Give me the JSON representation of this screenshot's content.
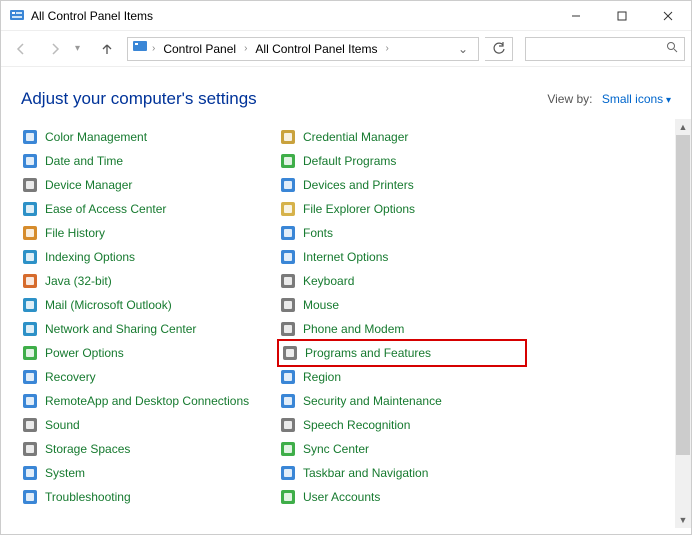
{
  "titlebar": {
    "title": "All Control Panel Items"
  },
  "breadcrumb": {
    "root": "Control Panel",
    "current": "All Control Panel Items"
  },
  "heading": "Adjust your computer's settings",
  "viewby": {
    "label": "View by:",
    "value": "Small icons"
  },
  "columns": [
    [
      {
        "id": "color-management",
        "label": "Color Management"
      },
      {
        "id": "date-and-time",
        "label": "Date and Time"
      },
      {
        "id": "device-manager",
        "label": "Device Manager"
      },
      {
        "id": "ease-of-access",
        "label": "Ease of Access Center"
      },
      {
        "id": "file-history",
        "label": "File History"
      },
      {
        "id": "indexing-options",
        "label": "Indexing Options"
      },
      {
        "id": "java",
        "label": "Java (32-bit)"
      },
      {
        "id": "mail",
        "label": "Mail (Microsoft Outlook)"
      },
      {
        "id": "network-sharing",
        "label": "Network and Sharing Center"
      },
      {
        "id": "power-options",
        "label": "Power Options"
      },
      {
        "id": "recovery",
        "label": "Recovery"
      },
      {
        "id": "remoteapp",
        "label": "RemoteApp and Desktop Connections"
      },
      {
        "id": "sound",
        "label": "Sound"
      },
      {
        "id": "storage-spaces",
        "label": "Storage Spaces"
      },
      {
        "id": "system",
        "label": "System"
      },
      {
        "id": "troubleshooting",
        "label": "Troubleshooting"
      }
    ],
    [
      {
        "id": "credential-manager",
        "label": "Credential Manager"
      },
      {
        "id": "default-programs",
        "label": "Default Programs"
      },
      {
        "id": "devices-printers",
        "label": "Devices and Printers"
      },
      {
        "id": "file-explorer-options",
        "label": "File Explorer Options"
      },
      {
        "id": "fonts",
        "label": "Fonts"
      },
      {
        "id": "internet-options",
        "label": "Internet Options"
      },
      {
        "id": "keyboard",
        "label": "Keyboard"
      },
      {
        "id": "mouse",
        "label": "Mouse"
      },
      {
        "id": "phone-modem",
        "label": "Phone and Modem"
      },
      {
        "id": "programs-features",
        "label": "Programs and Features",
        "highlighted": true
      },
      {
        "id": "region",
        "label": "Region"
      },
      {
        "id": "security-maintenance",
        "label": "Security and Maintenance"
      },
      {
        "id": "speech-recognition",
        "label": "Speech Recognition"
      },
      {
        "id": "sync-center",
        "label": "Sync Center"
      },
      {
        "id": "taskbar-navigation",
        "label": "Taskbar and Navigation"
      },
      {
        "id": "user-accounts",
        "label": "User Accounts"
      }
    ]
  ],
  "icon_colors": {
    "color-management": "#3a86d6",
    "date-and-time": "#3a86d6",
    "device-manager": "#7a7a7a",
    "ease-of-access": "#2d91c7",
    "file-history": "#d68c2c",
    "indexing-options": "#2d91c7",
    "java": "#d66b2c",
    "mail": "#2d91c7",
    "network-sharing": "#2d91c7",
    "power-options": "#3fae49",
    "recovery": "#3a86d6",
    "remoteapp": "#3a86d6",
    "sound": "#7a7a7a",
    "storage-spaces": "#7a7a7a",
    "system": "#3a86d6",
    "troubleshooting": "#3a86d6",
    "credential-manager": "#c9a23d",
    "default-programs": "#3fae49",
    "devices-printers": "#3a86d6",
    "file-explorer-options": "#d6b24a",
    "fonts": "#3a86d6",
    "internet-options": "#3a86d6",
    "keyboard": "#7a7a7a",
    "mouse": "#7a7a7a",
    "phone-modem": "#7a7a7a",
    "programs-features": "#7a7a7a",
    "region": "#3a86d6",
    "security-maintenance": "#3a86d6",
    "speech-recognition": "#7a7a7a",
    "sync-center": "#3fae49",
    "taskbar-navigation": "#3a86d6",
    "user-accounts": "#3fae49"
  }
}
